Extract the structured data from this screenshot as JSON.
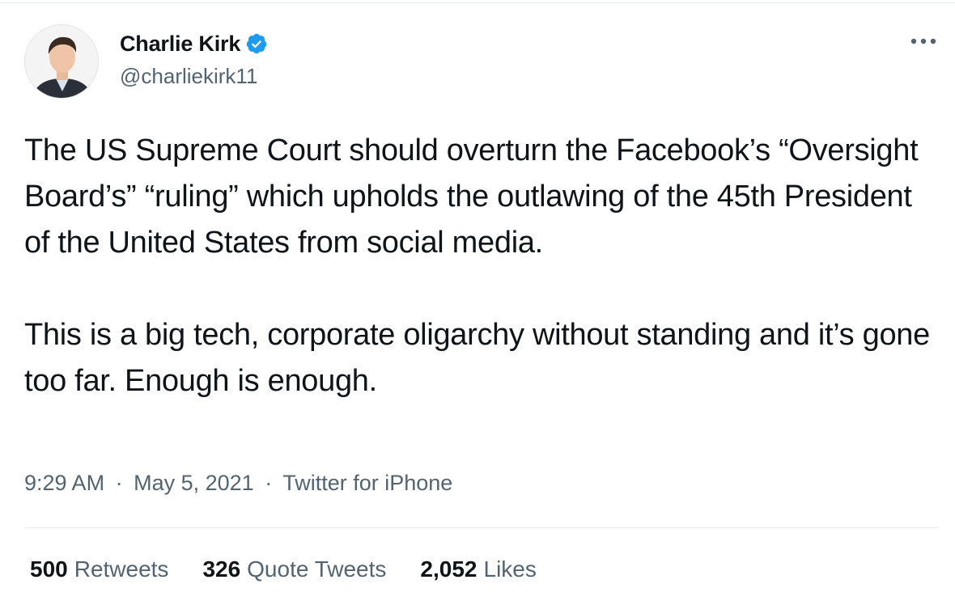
{
  "author": {
    "display_name": "Charlie Kirk",
    "handle": "@charliekirk11",
    "verified": true
  },
  "tweet": {
    "paragraphs": [
      "The US Supreme Court should overturn the Facebook’s “Oversight Board’s” “ruling” which upholds the outlawing of the 45th President of the United States from social media.",
      "This is a big tech, corporate oligarchy without standing and it’s gone too far. Enough is enough."
    ]
  },
  "meta": {
    "time": "9:29 AM",
    "separator": "·",
    "date": "May 5, 2021",
    "source": "Twitter for iPhone"
  },
  "stats": {
    "retweets": {
      "count": "500",
      "label": "Retweets"
    },
    "quotes": {
      "count": "326",
      "label": "Quote Tweets"
    },
    "likes": {
      "count": "2,052",
      "label": "Likes"
    }
  },
  "colors": {
    "verified_blue": "#1d9bf0",
    "secondary_text": "#536471",
    "primary_text": "#0f1419",
    "divider": "#e6ecf0"
  },
  "icons": {
    "verified": "verified-badge-icon",
    "more": "more-horizontal-icon"
  }
}
